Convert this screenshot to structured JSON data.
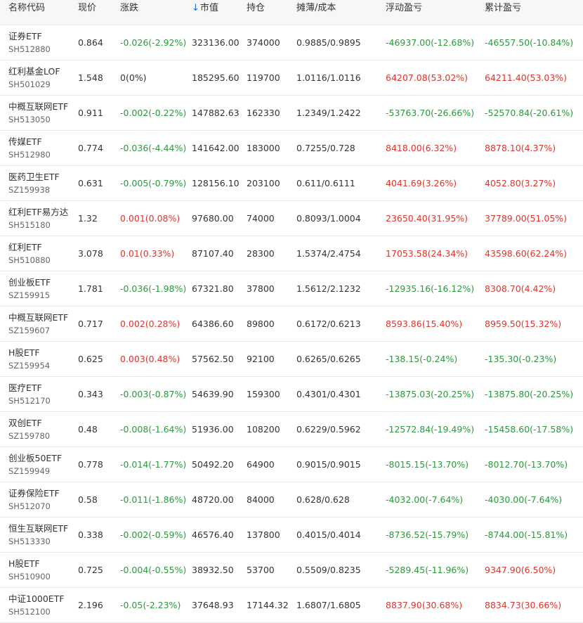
{
  "colors": {
    "up": "#e0332b",
    "down": "#2a9a3c",
    "flat": "#333333",
    "sort_accent": "#1b6ec9"
  },
  "header": {
    "name": "名称代码",
    "price": "现价",
    "change": "涨跌",
    "sort_icon": "arrow-down-icon",
    "market_value": "市值",
    "holding": "持仓",
    "cost": "摊薄/成本",
    "float_pnl": "浮动盈亏",
    "total_pnl": "累计盈亏"
  },
  "rows": [
    {
      "name": "证券ETF",
      "code": "SH512880",
      "price": "0.864",
      "change": "-0.026(-2.92%)",
      "change_dir": "down",
      "market_value": "323136.00",
      "holding": "374000",
      "cost": "0.9885/0.9895",
      "float_pnl": "-46937.00(-12.68%)",
      "float_dir": "down",
      "total_pnl": "-46557.50(-10.84%)",
      "total_dir": "down"
    },
    {
      "name": "红利基金LOF",
      "code": "SH501029",
      "price": "1.548",
      "change": "0(0%)",
      "change_dir": "flat",
      "market_value": "185295.60",
      "holding": "119700",
      "cost": "1.0116/1.0116",
      "float_pnl": "64207.08(53.02%)",
      "float_dir": "up",
      "total_pnl": "64211.40(53.03%)",
      "total_dir": "up"
    },
    {
      "name": "中概互联网ETF",
      "code": "SH513050",
      "price": "0.911",
      "change": "-0.002(-0.22%)",
      "change_dir": "down",
      "market_value": "147882.63",
      "holding": "162330",
      "cost": "1.2349/1.2422",
      "float_pnl": "-53763.70(-26.66%)",
      "float_dir": "down",
      "total_pnl": "-52570.84(-20.61%)",
      "total_dir": "down"
    },
    {
      "name": "传媒ETF",
      "code": "SH512980",
      "price": "0.774",
      "change": "-0.036(-4.44%)",
      "change_dir": "down",
      "market_value": "141642.00",
      "holding": "183000",
      "cost": "0.7255/0.728",
      "float_pnl": "8418.00(6.32%)",
      "float_dir": "up",
      "total_pnl": "8878.10(4.37%)",
      "total_dir": "up"
    },
    {
      "name": "医药卫生ETF",
      "code": "SZ159938",
      "price": "0.631",
      "change": "-0.005(-0.79%)",
      "change_dir": "down",
      "market_value": "128156.10",
      "holding": "203100",
      "cost": "0.611/0.6111",
      "float_pnl": "4041.69(3.26%)",
      "float_dir": "up",
      "total_pnl": "4052.80(3.27%)",
      "total_dir": "up"
    },
    {
      "name": "红利ETF易方达",
      "code": "SH515180",
      "price": "1.32",
      "change": "0.001(0.08%)",
      "change_dir": "up",
      "market_value": "97680.00",
      "holding": "74000",
      "cost": "0.8093/1.0004",
      "float_pnl": "23650.40(31.95%)",
      "float_dir": "up",
      "total_pnl": "37789.00(51.05%)",
      "total_dir": "up"
    },
    {
      "name": "红利ETF",
      "code": "SH510880",
      "price": "3.078",
      "change": "0.01(0.33%)",
      "change_dir": "up",
      "market_value": "87107.40",
      "holding": "28300",
      "cost": "1.5374/2.4754",
      "float_pnl": "17053.58(24.34%)",
      "float_dir": "up",
      "total_pnl": "43598.60(62.24%)",
      "total_dir": "up"
    },
    {
      "name": "创业板ETF",
      "code": "SZ159915",
      "price": "1.781",
      "change": "-0.036(-1.98%)",
      "change_dir": "down",
      "market_value": "67321.80",
      "holding": "37800",
      "cost": "1.5612/2.1232",
      "float_pnl": "-12935.16(-16.12%)",
      "float_dir": "down",
      "total_pnl": "8308.70(4.42%)",
      "total_dir": "up"
    },
    {
      "name": "中概互联网ETF",
      "code": "SZ159607",
      "price": "0.717",
      "change": "0.002(0.28%)",
      "change_dir": "up",
      "market_value": "64386.60",
      "holding": "89800",
      "cost": "0.6172/0.6213",
      "float_pnl": "8593.86(15.40%)",
      "float_dir": "up",
      "total_pnl": "8959.50(15.32%)",
      "total_dir": "up"
    },
    {
      "name": "H股ETF",
      "code": "SZ159954",
      "price": "0.625",
      "change": "0.003(0.48%)",
      "change_dir": "up",
      "market_value": "57562.50",
      "holding": "92100",
      "cost": "0.6265/0.6265",
      "float_pnl": "-138.15(-0.24%)",
      "float_dir": "down",
      "total_pnl": "-135.30(-0.23%)",
      "total_dir": "down"
    },
    {
      "name": "医疗ETF",
      "code": "SH512170",
      "price": "0.343",
      "change": "-0.003(-0.87%)",
      "change_dir": "down",
      "market_value": "54639.90",
      "holding": "159300",
      "cost": "0.4301/0.4301",
      "float_pnl": "-13875.03(-20.25%)",
      "float_dir": "down",
      "total_pnl": "-13875.80(-20.25%)",
      "total_dir": "down"
    },
    {
      "name": "双创ETF",
      "code": "SZ159780",
      "price": "0.48",
      "change": "-0.008(-1.64%)",
      "change_dir": "down",
      "market_value": "51936.00",
      "holding": "108200",
      "cost": "0.6229/0.5962",
      "float_pnl": "-12572.84(-19.49%)",
      "float_dir": "down",
      "total_pnl": "-15458.60(-17.58%)",
      "total_dir": "down"
    },
    {
      "name": "创业板50ETF",
      "code": "SZ159949",
      "price": "0.778",
      "change": "-0.014(-1.77%)",
      "change_dir": "down",
      "market_value": "50492.20",
      "holding": "64900",
      "cost": "0.9015/0.9015",
      "float_pnl": "-8015.15(-13.70%)",
      "float_dir": "down",
      "total_pnl": "-8012.70(-13.70%)",
      "total_dir": "down"
    },
    {
      "name": "证券保险ETF",
      "code": "SH512070",
      "price": "0.58",
      "change": "-0.011(-1.86%)",
      "change_dir": "down",
      "market_value": "48720.00",
      "holding": "84000",
      "cost": "0.628/0.628",
      "float_pnl": "-4032.00(-7.64%)",
      "float_dir": "down",
      "total_pnl": "-4030.00(-7.64%)",
      "total_dir": "down"
    },
    {
      "name": "恒生互联网ETF",
      "code": "SH513330",
      "price": "0.338",
      "change": "-0.002(-0.59%)",
      "change_dir": "down",
      "market_value": "46576.40",
      "holding": "137800",
      "cost": "0.4015/0.4014",
      "float_pnl": "-8736.52(-15.79%)",
      "float_dir": "down",
      "total_pnl": "-8744.00(-15.81%)",
      "total_dir": "down"
    },
    {
      "name": "H股ETF",
      "code": "SH510900",
      "price": "0.725",
      "change": "-0.004(-0.55%)",
      "change_dir": "down",
      "market_value": "38932.50",
      "holding": "53700",
      "cost": "0.5509/0.8235",
      "float_pnl": "-5289.45(-11.96%)",
      "float_dir": "down",
      "total_pnl": "9347.90(6.50%)",
      "total_dir": "up"
    },
    {
      "name": "中证1000ETF",
      "code": "SH512100",
      "price": "2.196",
      "change": "-0.05(-2.23%)",
      "change_dir": "down",
      "market_value": "37648.93",
      "holding": "17144.32",
      "cost": "1.6807/1.6805",
      "float_pnl": "8837.90(30.68%)",
      "float_dir": "up",
      "total_pnl": "8834.73(30.66%)",
      "total_dir": "up"
    }
  ]
}
